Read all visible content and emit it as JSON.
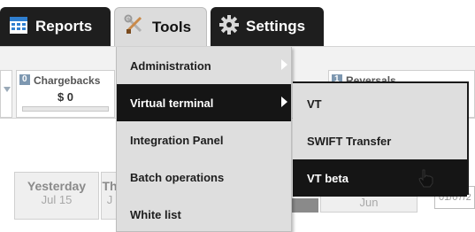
{
  "tabs": [
    {
      "label": "Reports",
      "icon": "calendar-icon"
    },
    {
      "label": "Tools",
      "icon": "tools-icon"
    },
    {
      "label": "Settings",
      "icon": "gear-icon"
    }
  ],
  "stats": {
    "chargebacks": {
      "count": "0",
      "title": "Chargebacks",
      "value": "$ 0"
    },
    "reversals": {
      "count": "1",
      "title": "Reversals"
    }
  },
  "dates": {
    "yesterday": {
      "label": "Yesterday",
      "date": "Jul 15"
    },
    "cut_label": "Th",
    "cut_date": "J",
    "jun_label": "Jun",
    "input_value": "01/07/2"
  },
  "tools_menu": {
    "items": [
      {
        "label": "Administration",
        "has_arrow": true
      },
      {
        "label": "Virtual terminal",
        "has_arrow": true
      },
      {
        "label": "Integration Panel"
      },
      {
        "label": "Batch operations"
      },
      {
        "label": "White list"
      }
    ]
  },
  "vt_submenu": {
    "items": [
      {
        "label": "VT"
      },
      {
        "label": "SWIFT Transfer"
      },
      {
        "label": "VT beta"
      }
    ]
  },
  "colors": {
    "tab_dark": "#1e1e1e",
    "menu_bg": "#dedede",
    "menu_active": "#151515",
    "badge": "#7d97b0"
  }
}
